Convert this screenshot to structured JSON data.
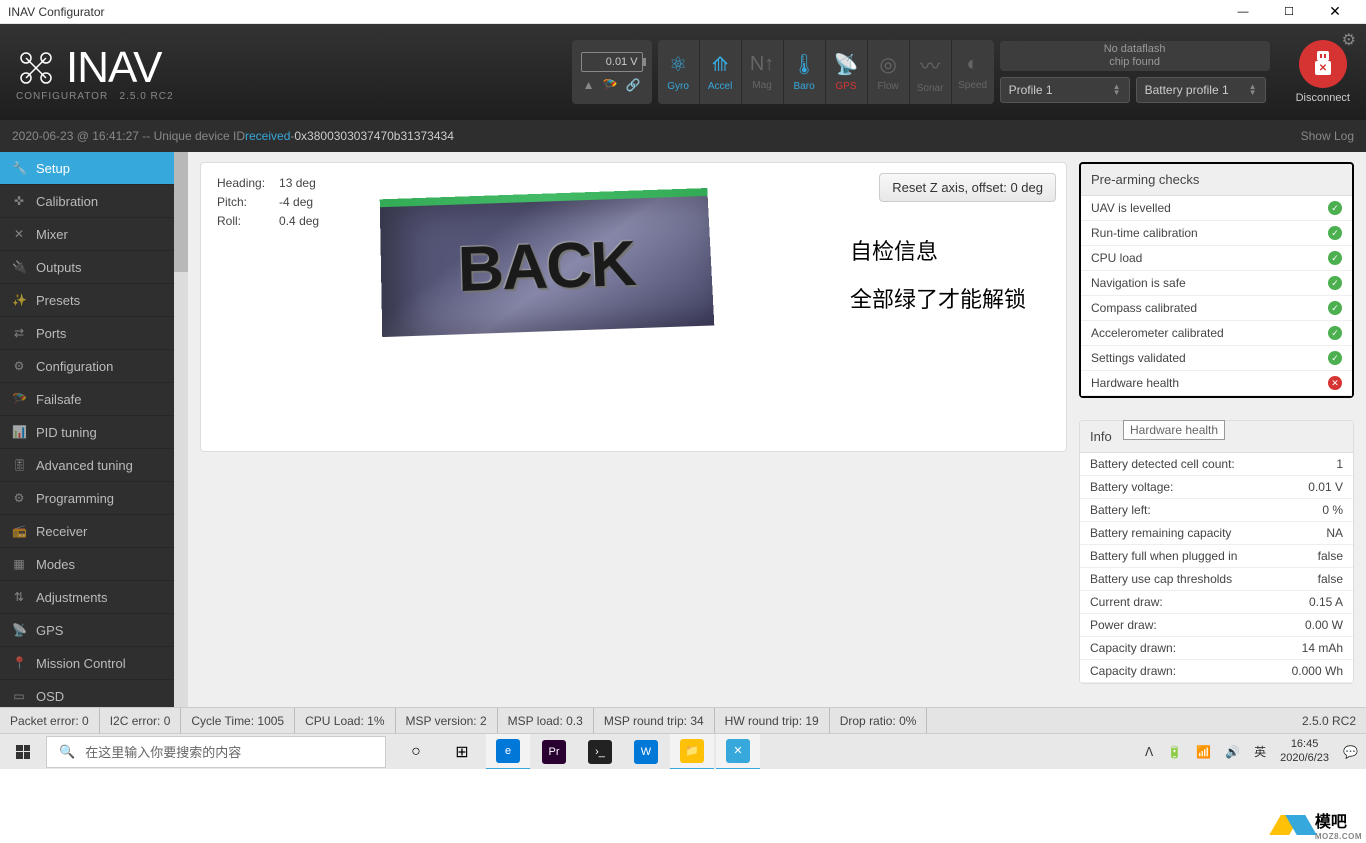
{
  "window": {
    "title": "INAV Configurator"
  },
  "logo": {
    "main": "INAV",
    "sub": "CONFIGURATOR",
    "ver": "2.5.0 RC2"
  },
  "header": {
    "voltage": "0.01 V",
    "sensors": [
      {
        "label": "Gyro",
        "state": "on",
        "icon": "⚛"
      },
      {
        "label": "Accel",
        "state": "on",
        "icon": "⟰"
      },
      {
        "label": "Mag",
        "state": "off",
        "icon": "N↑"
      },
      {
        "label": "Baro",
        "state": "on",
        "icon": "🌡"
      },
      {
        "label": "GPS",
        "state": "err",
        "icon": "📡"
      },
      {
        "label": "Flow",
        "state": "off",
        "icon": "◎"
      },
      {
        "label": "Sonar",
        "state": "off",
        "icon": "〰"
      },
      {
        "label": "Speed",
        "state": "off",
        "icon": "◐"
      }
    ],
    "dataflash_l1": "No dataflash",
    "dataflash_l2": "chip found",
    "profile": "Profile 1",
    "battery_profile": "Battery profile 1",
    "disconnect": "Disconnect"
  },
  "log": {
    "ts": "2020-06-23 @ 16:41:27",
    "txt1": "-- Unique device ID ",
    "rcv": "received",
    "txt2": " - ",
    "hex": "0x3800303037470b31373434",
    "show": "Show Log"
  },
  "nav": [
    {
      "label": "Setup",
      "icon": "🔧",
      "active": true
    },
    {
      "label": "Calibration",
      "icon": "✜"
    },
    {
      "label": "Mixer",
      "icon": "✕"
    },
    {
      "label": "Outputs",
      "icon": "🔌"
    },
    {
      "label": "Presets",
      "icon": "✨"
    },
    {
      "label": "Ports",
      "icon": "⇄"
    },
    {
      "label": "Configuration",
      "icon": "⚙"
    },
    {
      "label": "Failsafe",
      "icon": "🪂"
    },
    {
      "label": "PID tuning",
      "icon": "📊"
    },
    {
      "label": "Advanced tuning",
      "icon": "🎚"
    },
    {
      "label": "Programming",
      "icon": "⚙"
    },
    {
      "label": "Receiver",
      "icon": "📻"
    },
    {
      "label": "Modes",
      "icon": "▦"
    },
    {
      "label": "Adjustments",
      "icon": "⇅"
    },
    {
      "label": "GPS",
      "icon": "📡"
    },
    {
      "label": "Mission Control",
      "icon": "📍"
    },
    {
      "label": "OSD",
      "icon": "▭"
    }
  ],
  "attitude": {
    "heading_lbl": "Heading:",
    "heading": "13 deg",
    "pitch_lbl": "Pitch:",
    "pitch": "-4 deg",
    "roll_lbl": "Roll:",
    "roll": "0.4 deg"
  },
  "reset_btn": "Reset Z axis, offset: 0 deg",
  "back_text": "BACK",
  "annot": {
    "l1": "自检信息",
    "l2": "全部绿了才能解锁"
  },
  "prearm": {
    "title": "Pre-arming checks",
    "items": [
      {
        "label": "UAV is levelled",
        "ok": true
      },
      {
        "label": "Run-time calibration",
        "ok": true
      },
      {
        "label": "CPU load",
        "ok": true
      },
      {
        "label": "Navigation is safe",
        "ok": true
      },
      {
        "label": "Compass calibrated",
        "ok": true
      },
      {
        "label": "Accelerometer calibrated",
        "ok": true
      },
      {
        "label": "Settings validated",
        "ok": true
      },
      {
        "label": "Hardware health",
        "ok": false
      }
    ],
    "tooltip": "Hardware health"
  },
  "info": {
    "title": "Info",
    "rows": [
      {
        "label": "Battery detected cell count:",
        "val": "1"
      },
      {
        "label": "Battery voltage:",
        "val": "0.01 V"
      },
      {
        "label": "Battery left:",
        "val": "0 %"
      },
      {
        "label": "Battery remaining capacity",
        "val": "NA"
      },
      {
        "label": "Battery full when plugged in",
        "val": "false"
      },
      {
        "label": "Battery use cap thresholds",
        "val": "false"
      },
      {
        "label": "Current draw:",
        "val": "0.15 A"
      },
      {
        "label": "Power draw:",
        "val": "0.00 W"
      },
      {
        "label": "Capacity drawn:",
        "val": "14 mAh"
      },
      {
        "label": "Capacity drawn:",
        "val": "0.000 Wh"
      }
    ]
  },
  "status": {
    "cells": [
      "Packet error: 0",
      "I2C error: 0",
      "Cycle Time: 1005",
      "CPU Load: 1%",
      "MSP version: 2",
      "MSP load: 0.3",
      "MSP round trip: 34",
      "HW round trip: 19",
      "Drop ratio: 0%"
    ],
    "ver": "2.5.0 RC2"
  },
  "taskbar": {
    "search_placeholder": "在这里输入你要搜索的内容",
    "ime": "英",
    "time": "16:45",
    "date": "2020/6/23"
  },
  "watermark": {
    "txt": "模吧",
    "sub": "MOZ8.COM"
  }
}
